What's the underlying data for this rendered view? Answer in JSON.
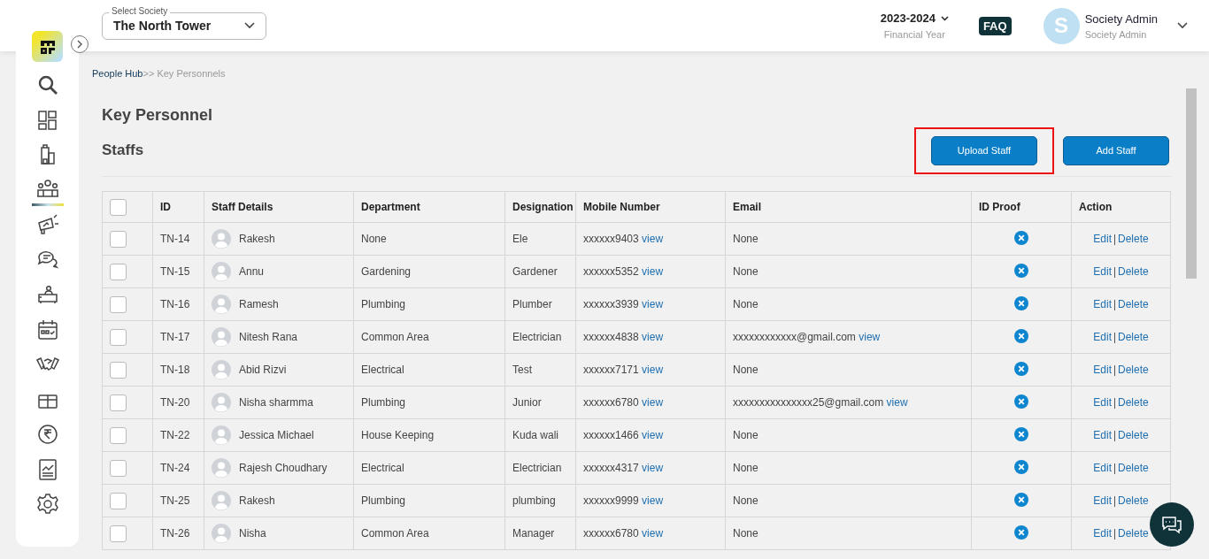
{
  "header": {
    "society_label": "Select Society",
    "society": "The North Tower",
    "year": "2023-2024",
    "year_caption": "Financial Year",
    "faq": "FAQ",
    "avatar_letter": "S",
    "user_name": "Society Admin",
    "user_role": "Society Admin"
  },
  "sidebar": {
    "items": [
      {
        "kind": "search",
        "selected": false
      },
      {
        "kind": "dashboard",
        "selected": false
      },
      {
        "kind": "building",
        "selected": false
      },
      {
        "kind": "people",
        "selected": true
      },
      {
        "kind": "megaphone",
        "selected": false
      },
      {
        "kind": "chat",
        "selected": false
      },
      {
        "kind": "desk",
        "selected": false
      },
      {
        "kind": "calendar",
        "selected": false
      },
      {
        "kind": "handshake",
        "selected": false
      },
      {
        "kind": "box",
        "selected": false
      },
      {
        "kind": "rupee",
        "selected": false
      },
      {
        "kind": "report",
        "selected": false
      },
      {
        "kind": "settings",
        "selected": false
      }
    ]
  },
  "breadcrumb": {
    "parent": "People Hub",
    "separator": ">>",
    "current": "Key Personnels"
  },
  "page_title": "Key Personnel",
  "section_title": "Staffs",
  "buttons": [
    {
      "label": "Upload Staff",
      "highlighted": true
    },
    {
      "label": "Add Staff",
      "highlighted": false
    }
  ],
  "table": {
    "select_all_checked": false,
    "columns": [
      "ID",
      "Staff Details",
      "Department",
      "Designation",
      "Mobile Number",
      "Email",
      "ID Proof",
      "Action"
    ],
    "rows": [
      {
        "checked": false,
        "id": "TN-14",
        "name": "Rakesh",
        "department": "None",
        "designation": "Ele",
        "mobile": "xxxxxx9403",
        "mobile_link": "view",
        "email": "None",
        "id_proof_uploaded": false,
        "edit": "Edit",
        "delete": "Delete"
      },
      {
        "checked": false,
        "id": "TN-15",
        "name": "Annu",
        "department": "Gardening",
        "designation": "Gardener",
        "mobile": "xxxxxx5352",
        "mobile_link": "view",
        "email": "None",
        "id_proof_uploaded": false,
        "edit": "Edit",
        "delete": "Delete"
      },
      {
        "checked": false,
        "id": "TN-16",
        "name": "Ramesh",
        "department": "Plumbing",
        "designation": "Plumber",
        "mobile": "xxxxxx3939",
        "mobile_link": "view",
        "email": "None",
        "id_proof_uploaded": false,
        "edit": "Edit",
        "delete": "Delete"
      },
      {
        "checked": false,
        "id": "TN-17",
        "name": "Nitesh Rana",
        "department": "Common Area",
        "designation": "Electrician",
        "mobile": "xxxxxx4838",
        "mobile_link": "view",
        "email": "xxxxxxxxxxxx@gmail.com",
        "email_link": "view",
        "id_proof_uploaded": false,
        "edit": "Edit",
        "delete": "Delete"
      },
      {
        "checked": false,
        "id": "TN-18",
        "name": "Abid Rizvi",
        "department": "Electrical",
        "designation": "Test",
        "mobile": "xxxxxx7171",
        "mobile_link": "view",
        "email": "None",
        "id_proof_uploaded": false,
        "edit": "Edit",
        "delete": "Delete"
      },
      {
        "checked": false,
        "id": "TN-20",
        "name": "Nisha sharmma",
        "department": "Plumbing",
        "designation": "Junior",
        "mobile": "xxxxxx6780",
        "mobile_link": "view",
        "email": "xxxxxxxxxxxxxxx25@gmail.com",
        "email_link": "view",
        "id_proof_uploaded": false,
        "edit": "Edit",
        "delete": "Delete"
      },
      {
        "checked": false,
        "id": "TN-22",
        "name": "Jessica Michael",
        "department": "House Keeping",
        "designation": "Kuda wali",
        "mobile": "xxxxxx1466",
        "mobile_link": "view",
        "email": "None",
        "id_proof_uploaded": false,
        "edit": "Edit",
        "delete": "Delete"
      },
      {
        "checked": false,
        "id": "TN-24",
        "name": "Rajesh Choudhary",
        "department": "Electrical",
        "designation": "Electrician",
        "mobile": "xxxxxx4317",
        "mobile_link": "view",
        "email": "None",
        "id_proof_uploaded": false,
        "edit": "Edit",
        "delete": "Delete"
      },
      {
        "checked": false,
        "id": "TN-25",
        "name": "Rakesh",
        "department": "Plumbing",
        "designation": "plumbing",
        "mobile": "xxxxxx9999",
        "mobile_link": "view",
        "email": "None",
        "id_proof_uploaded": false,
        "edit": "Edit",
        "delete": "Delete"
      },
      {
        "checked": false,
        "id": "TN-26",
        "name": "Nisha",
        "department": "Common Area",
        "designation": "Manager",
        "mobile": "xxxxxx6780",
        "mobile_link": "view",
        "email": "None",
        "id_proof_uploaded": false,
        "edit": "Edit",
        "delete": "Delete"
      }
    ]
  }
}
